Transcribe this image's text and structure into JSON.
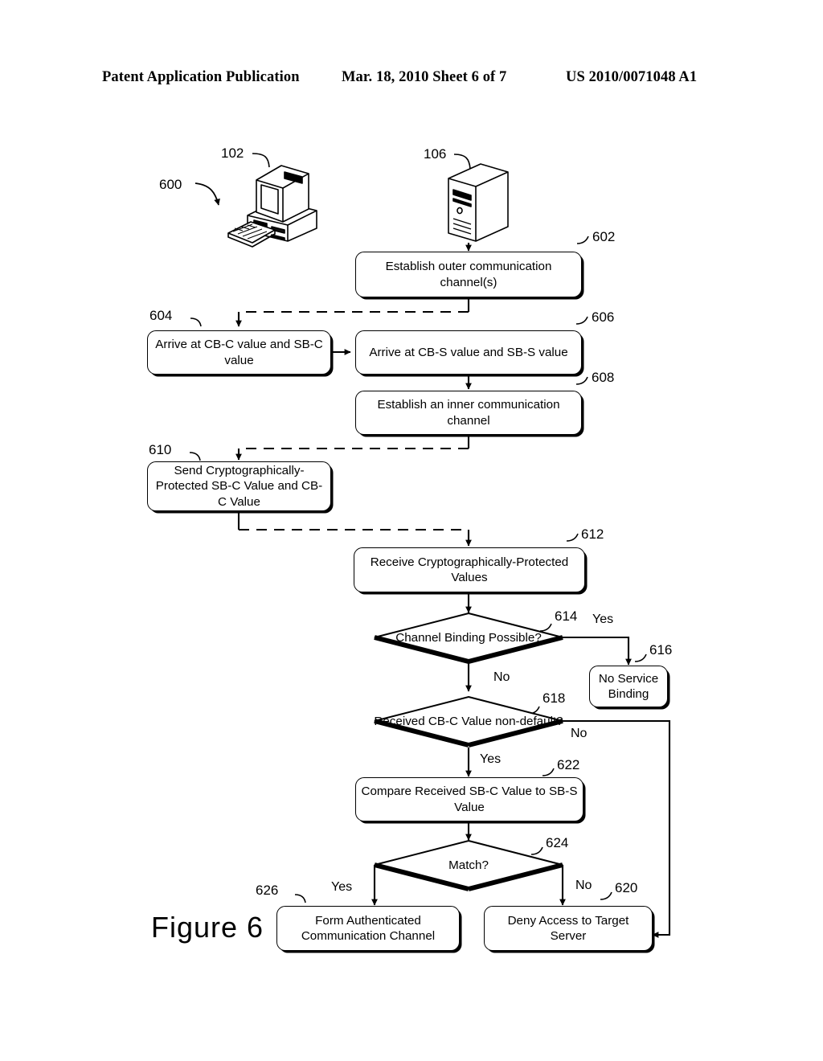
{
  "header": {
    "left": "Patent Application Publication",
    "middle": "Mar. 18, 2010  Sheet 6 of 7",
    "right": "US 2010/0071048 A1"
  },
  "figure": {
    "caption": "Figure  6",
    "diagram_ref": "600"
  },
  "devices": [
    {
      "ref": "102",
      "name": "client-computer"
    },
    {
      "ref": "106",
      "name": "server-tower"
    }
  ],
  "nodes": [
    {
      "id": "602",
      "ref": "602",
      "type": "process",
      "text": "Establish outer communication channel(s)"
    },
    {
      "id": "604",
      "ref": "604",
      "type": "process",
      "text": "Arrive at CB-C value and SB-C value"
    },
    {
      "id": "606",
      "ref": "606",
      "type": "process",
      "text": "Arrive at CB-S value and SB-S value"
    },
    {
      "id": "608",
      "ref": "608",
      "type": "process",
      "text": "Establish an inner communication channel"
    },
    {
      "id": "610",
      "ref": "610",
      "type": "process",
      "text": "Send Cryptographically-Protected SB-C Value  and CB-C Value"
    },
    {
      "id": "612",
      "ref": "612",
      "type": "process",
      "text": "Receive Cryptographically-Protected Values"
    },
    {
      "id": "614",
      "ref": "614",
      "type": "decision",
      "text": "Channel Binding Possible?"
    },
    {
      "id": "616",
      "ref": "616",
      "type": "process",
      "text": "No Service Binding"
    },
    {
      "id": "618",
      "ref": "618",
      "type": "decision",
      "text": "Received CB-C Value non-default?"
    },
    {
      "id": "622",
      "ref": "622",
      "type": "process",
      "text": "Compare Received SB-C Value to SB-S Value"
    },
    {
      "id": "624",
      "ref": "624",
      "type": "decision",
      "text": "Match?"
    },
    {
      "id": "626",
      "ref": "626",
      "type": "process",
      "text": "Form Authenticated Communication Channel"
    },
    {
      "id": "620",
      "ref": "620",
      "type": "process",
      "text": "Deny Access to Target Server"
    }
  ],
  "branch_labels": {
    "b614_yes": "Yes",
    "b614_no": "No",
    "b618_no": "No",
    "b618_yes": "Yes",
    "b624_yes": "Yes",
    "b624_no": "No"
  },
  "colors": {
    "ink": "#000000",
    "paper": "#ffffff"
  }
}
